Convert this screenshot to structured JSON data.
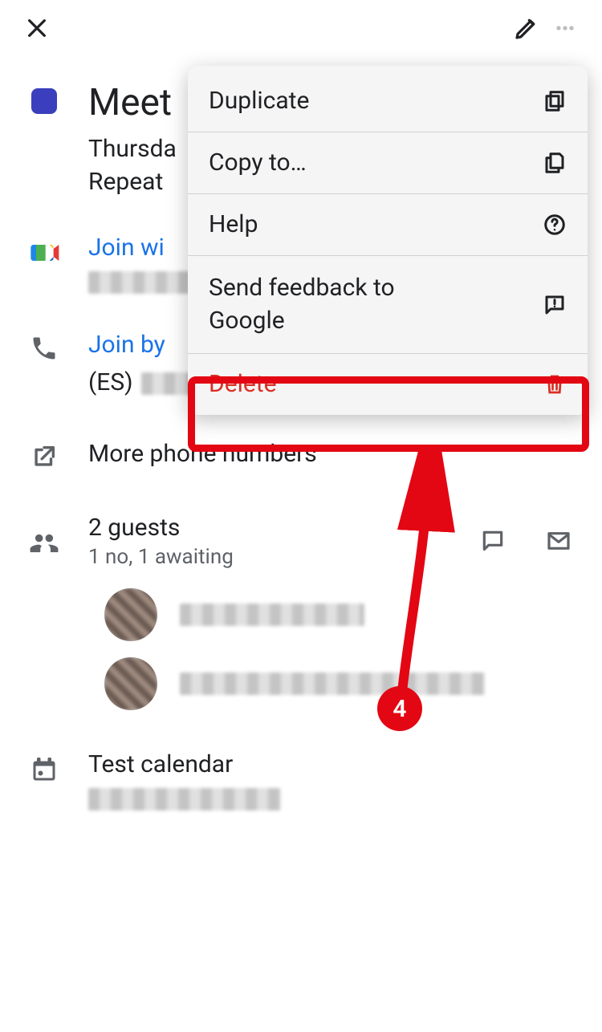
{
  "topbar": {},
  "event": {
    "title": "Meet",
    "date_line": "Thursda",
    "repeat_line": "Repeat"
  },
  "meet": {
    "join_link_text": "Join wi"
  },
  "phone": {
    "join_by_text": "Join by",
    "country_prefix": "(ES)",
    "more_numbers": "More phone numbers"
  },
  "guests": {
    "count_text": "2 guests",
    "status_text": "1 no, 1 awaiting"
  },
  "calendar": {
    "name": "Test calendar"
  },
  "menu": {
    "duplicate": "Duplicate",
    "copy_to": "Copy to…",
    "help": "Help",
    "feedback": "Send feedback to Google",
    "delete": "Delete"
  },
  "annotation": {
    "step_number": "4"
  }
}
